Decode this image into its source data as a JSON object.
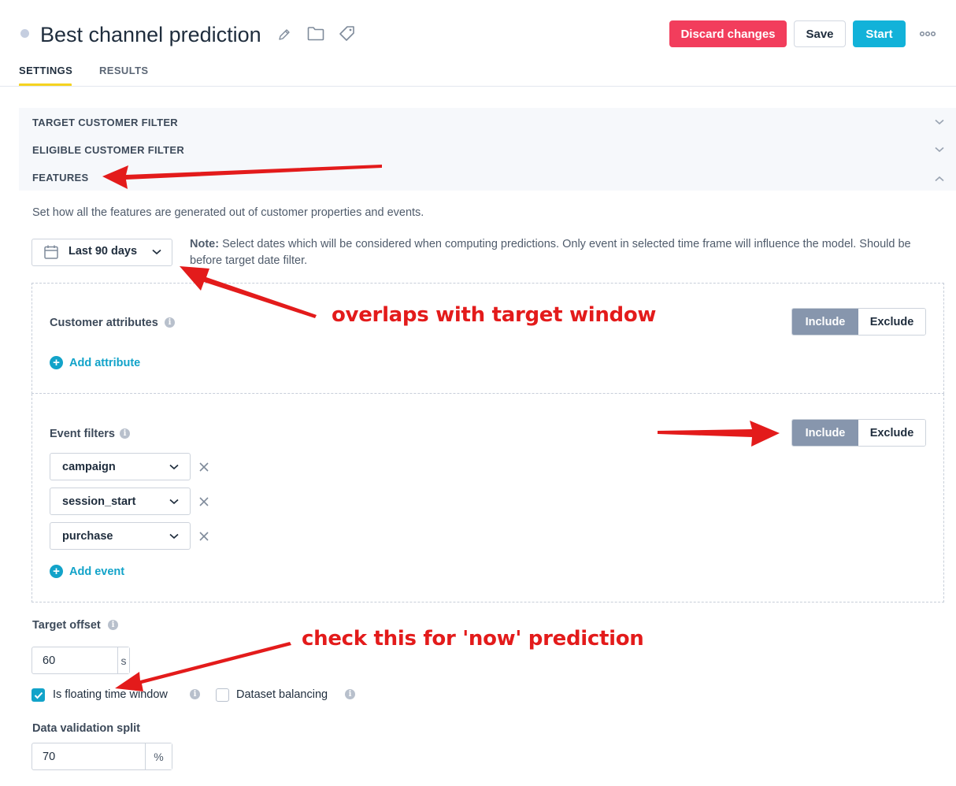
{
  "header": {
    "title": "Best channel prediction",
    "discard_label": "Discard changes",
    "save_label": "Save",
    "start_label": "Start",
    "more_label": "ooo"
  },
  "tabs": [
    {
      "label": "SETTINGS",
      "active": true
    },
    {
      "label": "RESULTS",
      "active": false
    }
  ],
  "accordion": [
    {
      "label": "TARGET CUSTOMER FILTER",
      "expanded": false
    },
    {
      "label": "ELIGIBLE CUSTOMER FILTER",
      "expanded": false
    },
    {
      "label": "FEATURES",
      "expanded": true
    }
  ],
  "features": {
    "description": "Set how all the features are generated out of customer properties and events.",
    "date_range": "Last 90 days",
    "note_bold": "Note:",
    "note_text": " Select dates which will be considered when computing predictions. Only event in selected time frame will influence the model. Should be before target date filter.",
    "customer_attributes": {
      "label": "Customer attributes",
      "include_label": "Include",
      "exclude_label": "Exclude",
      "selected": "Include",
      "add_label": "Add attribute"
    },
    "event_filters": {
      "label": "Event filters",
      "include_label": "Include",
      "exclude_label": "Exclude",
      "selected": "Include",
      "events": [
        "campaign",
        "session_start",
        "purchase"
      ],
      "add_label": "Add event"
    }
  },
  "target_offset": {
    "label": "Target offset",
    "value": "60",
    "unit": "s"
  },
  "checkboxes": [
    {
      "label": "Is floating time window",
      "checked": true
    },
    {
      "label": "Dataset balancing",
      "checked": false
    }
  ],
  "data_validation_split": {
    "label": "Data validation split",
    "value": "70",
    "unit": "%"
  },
  "annotations": {
    "overlap": "overlaps with target window",
    "now": "check this for 'now' prediction"
  },
  "colors": {
    "discard": "#f23d5c",
    "start": "#12b2d9",
    "accent": "#12a3c9",
    "tab_underline": "#f5d320",
    "segment_active": "#8796ad",
    "annotation": "#e31b1b"
  }
}
